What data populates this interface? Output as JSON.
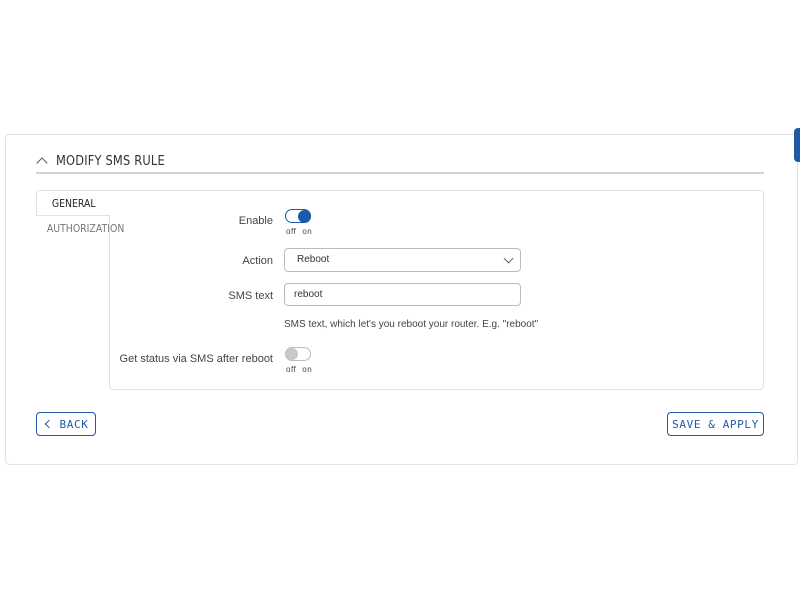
{
  "section": {
    "title": "MODIFY SMS RULE"
  },
  "tabs": [
    {
      "label": "GENERAL",
      "active": true
    },
    {
      "label": "AUTHORIZATION",
      "active": false
    }
  ],
  "form": {
    "enable": {
      "label": "Enable",
      "state": "on",
      "off_text": "off",
      "on_text": "on"
    },
    "action": {
      "label": "Action",
      "value": "Reboot"
    },
    "sms_text": {
      "label": "SMS text",
      "value": "reboot",
      "hint": "SMS text, which let's you reboot your router. E.g. \"reboot\""
    },
    "get_status": {
      "label": "Get status via SMS after reboot",
      "state": "off",
      "off_text": "off",
      "on_text": "on"
    }
  },
  "buttons": {
    "back": "BACK",
    "save_apply": "SAVE & APPLY"
  },
  "colors": {
    "accent": "#1f5aa6",
    "border": "#e2e2e2"
  },
  "icons": {
    "collapse": "chevron-up-icon",
    "back": "chevron-left-icon",
    "select": "chevron-down-icon"
  }
}
